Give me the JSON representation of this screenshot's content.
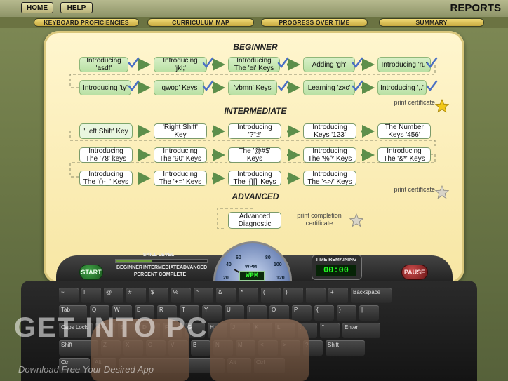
{
  "topbar": {
    "home_label": "HOME",
    "help_label": "HELP",
    "title": "REPORTS"
  },
  "tabs": [
    {
      "label": "KEYBOARD PROFICIENCIES"
    },
    {
      "label": "CURRICULUM MAP"
    },
    {
      "label": "PROGRESS OVER TIME"
    },
    {
      "label": "SUMMARY"
    }
  ],
  "curriculum": {
    "beginner": {
      "title": "BEGINNER",
      "row1": [
        "Introducing 'asdf'",
        "Introducing 'jkl;'",
        "Introducing The 'ei' Keys",
        "Adding 'gh'",
        "Introducing 'ru'"
      ],
      "row2": [
        "Introducing 'ty'",
        "'qwop' Keys",
        "'vbmn' Keys",
        "Learning 'zxc'",
        "Introducing ',.'"
      ],
      "print": "print certificate"
    },
    "intermediate": {
      "title": "INTERMEDIATE",
      "row1": [
        "'Left Shift' Key",
        "'Right Shift' Key",
        "Introducing '?\":!'",
        "Introducing Keys '123'",
        "The Number Keys '456'"
      ],
      "row2": [
        "Introducing The '78' keys",
        "Introducing The '90' Keys",
        "The '@#$' Keys",
        "Introducing The '%^' Keys",
        "Introducing The '&*' Keys"
      ],
      "row3": [
        "Introducing The '()-_' Keys",
        "Introducing The '+=' Keys",
        "Introducing The '{}[]' Keys",
        "Introducing The '<>/' Keys"
      ],
      "print": "print certificate"
    },
    "advanced": {
      "title": "ADVANCED",
      "node": "Advanced Diagnostic",
      "print": "print completion certificate"
    }
  },
  "console": {
    "start": "START",
    "pause": "PAUSE",
    "skill_level": "SKILL LEVEL",
    "levels": [
      "BEGINNER",
      "INTERMEDIATE",
      "ADVANCED"
    ],
    "percent_complete": "PERCENT COMPLETE",
    "gauge_ticks": [
      "20",
      "40",
      "60",
      "80",
      "100",
      "120"
    ],
    "wpm_label": "WPM",
    "wpm_value": "WPM",
    "time_label": "TIME REMAINING",
    "time_value": "00:00"
  },
  "keyboard": {
    "row1": [
      "~",
      "!",
      "@",
      "#",
      "$",
      "%",
      "^",
      "&",
      "*",
      "(",
      ")",
      "_",
      "+",
      "Backspace"
    ],
    "row2": [
      "Tab",
      "Q",
      "W",
      "E",
      "R",
      "T",
      "Y",
      "U",
      "I",
      "O",
      "P",
      "{",
      "}",
      "|"
    ],
    "row3": [
      "Caps Lock",
      "A",
      "S",
      "D",
      "F",
      "G",
      "H",
      "J",
      "K",
      "L",
      ":",
      "\"",
      "Enter"
    ],
    "row4": [
      "Shift",
      "Z",
      "X",
      "C",
      "V",
      "B",
      "N",
      "M",
      "<",
      ">",
      "?",
      "Shift"
    ],
    "row5": [
      "Ctrl",
      "Alt",
      "",
      "Alt",
      "Ctrl"
    ]
  },
  "watermark": {
    "big": "GET INTO PC",
    "small": "Download Free Your Desired App"
  }
}
